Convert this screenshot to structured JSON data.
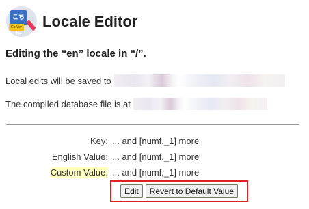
{
  "app": {
    "title": "Locale Editor",
    "logo": {
      "icon": "locale-editor-logo-icon",
      "badge_text": "こちに",
      "tag_text": "Co.Ver"
    }
  },
  "page": {
    "heading": "Editing the “en” locale in “/”.",
    "save_info": "Local edits will be saved to",
    "db_info": "The compiled database file is at"
  },
  "fields": {
    "key_label": "Key:",
    "key_value": "... and [numf,_1] more",
    "english_label": "English Value:",
    "english_value": "... and [numf,_1] more",
    "custom_label": "Custom Value",
    "custom_colon": ":",
    "custom_value": "... and [numf,_1] more"
  },
  "buttons": {
    "edit": "Edit",
    "revert": "Revert to Default Value"
  },
  "colors": {
    "highlight": "#ffffc0",
    "focus_outline": "#e0201e"
  }
}
